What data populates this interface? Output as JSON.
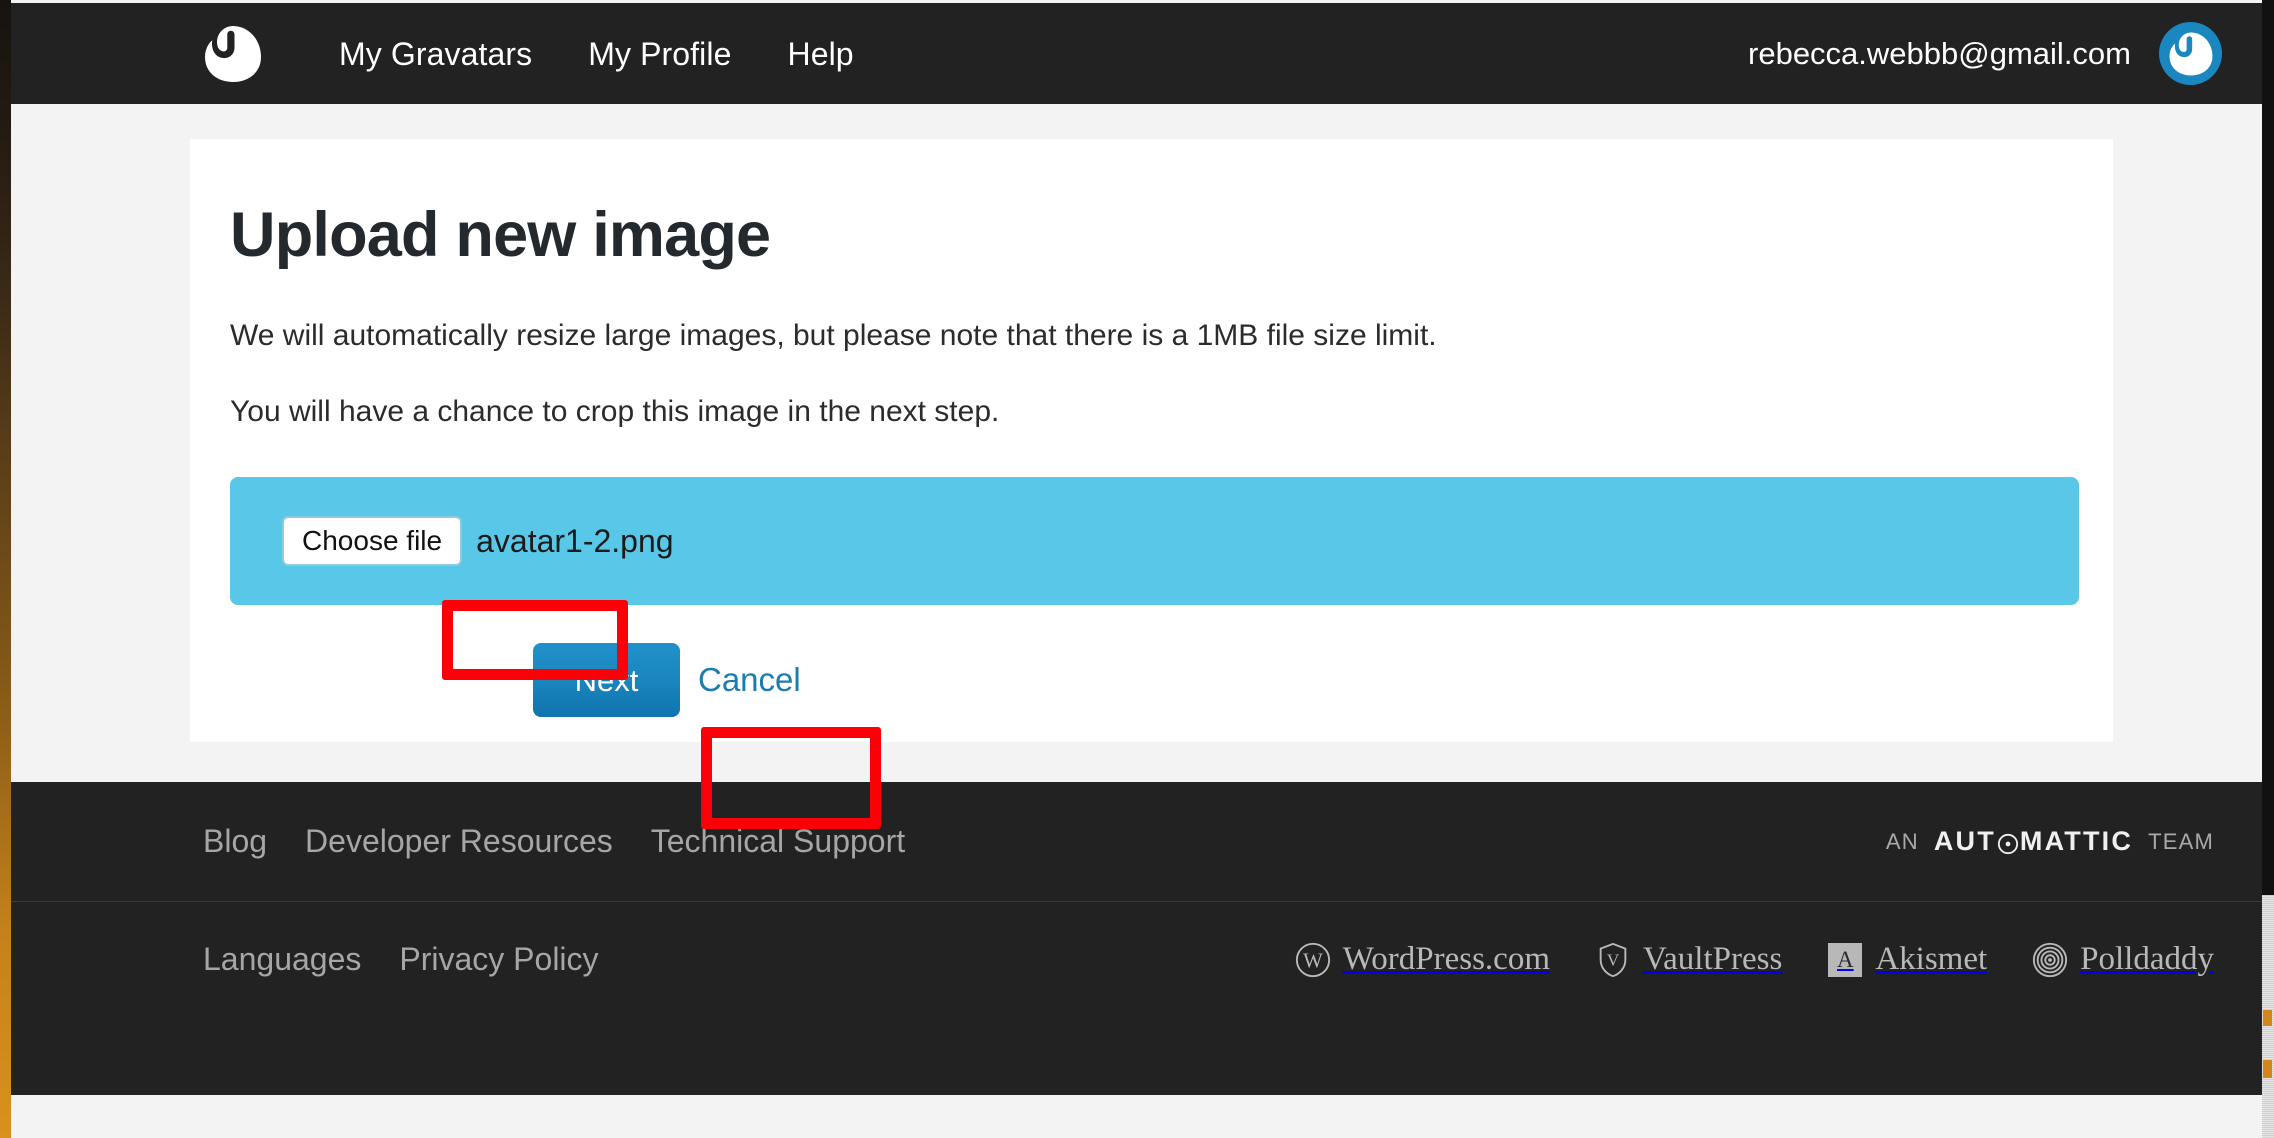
{
  "header": {
    "logo_icon": "gravatar-logo-icon",
    "nav": [
      {
        "label": "My Gravatars"
      },
      {
        "label": "My Profile"
      },
      {
        "label": "Help"
      }
    ],
    "account_email": "rebecca.webbb@gmail.com",
    "avatar_icon": "gravatar-avatar-icon"
  },
  "main": {
    "title": "Upload new image",
    "paragraph1": "We will automatically resize large images, but please note that there is a 1MB file size limit.",
    "paragraph2": "You will have a chance to crop this image in the next step.",
    "file_input": {
      "choose_label": "Choose file",
      "file_name": "avatar1-2.png"
    },
    "next_label": "Next",
    "cancel_label": "Cancel"
  },
  "footer": {
    "links_top": [
      {
        "label": "Blog"
      },
      {
        "label": "Developer Resources"
      },
      {
        "label": "Technical Support"
      }
    ],
    "links_bottom": [
      {
        "label": "Languages"
      },
      {
        "label": "Privacy Policy"
      }
    ],
    "automattic": {
      "prefix": "AN",
      "brand_before": "AUT",
      "brand_after": "MATTIC",
      "suffix": "TEAM"
    },
    "products": [
      {
        "name": "WordPress.com",
        "icon": "wordpress-icon"
      },
      {
        "name": "VaultPress",
        "icon": "vaultpress-shield-icon"
      },
      {
        "name": "Akismet",
        "icon": "akismet-icon",
        "letter": "A"
      },
      {
        "name": "Polldaddy",
        "icon": "polldaddy-spiral-icon"
      }
    ]
  },
  "colors": {
    "nav_bg": "#222222",
    "page_bg": "#f3f3f3",
    "card_bg": "#ffffff",
    "file_zone": "#59c7e8",
    "accent_blue": "#1b87c0",
    "link_blue": "#1b7cb0",
    "annotation_red": "#fb0007"
  }
}
